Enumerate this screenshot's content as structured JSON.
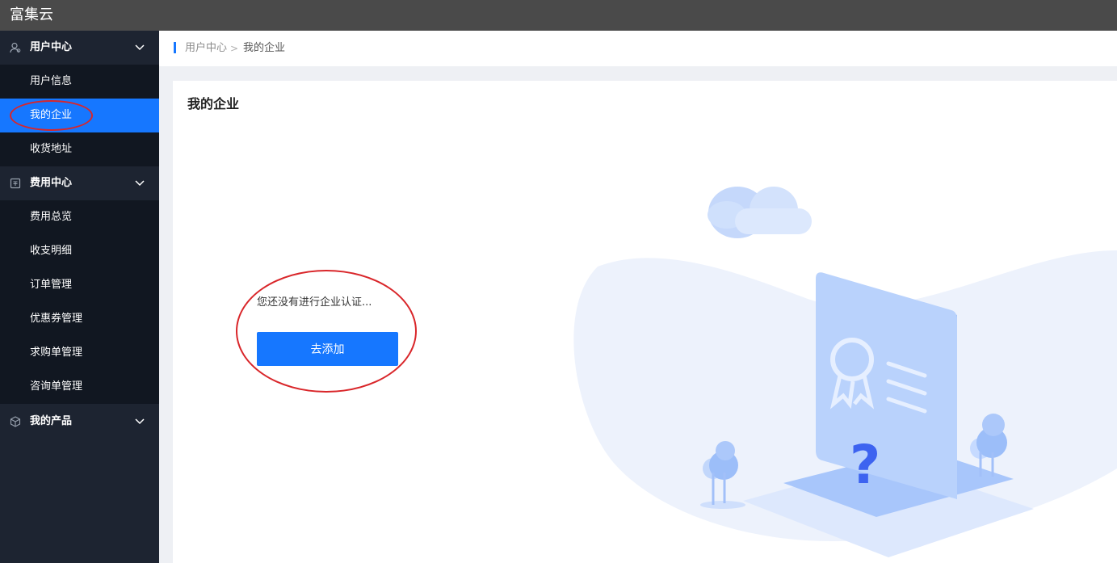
{
  "app": {
    "title": "富集云"
  },
  "sidebar": {
    "groups": [
      {
        "label": "用户中心",
        "icon": "user-icon",
        "items": [
          "用户信息",
          "我的企业",
          "收货地址"
        ]
      },
      {
        "label": "费用中心",
        "icon": "receipt-icon",
        "items": [
          "费用总览",
          "收支明细",
          "订单管理",
          "优惠券管理",
          "求购单管理",
          "咨询单管理"
        ]
      },
      {
        "label": "我的产品",
        "icon": "cube-icon",
        "items": []
      }
    ],
    "active_item": "我的企业"
  },
  "breadcrumb": {
    "items": [
      "用户中心",
      "我的企业"
    ],
    "separator": ">"
  },
  "main": {
    "title": "我的企业",
    "empty_message": "您还没有进行企业认证...",
    "add_button": "去添加"
  },
  "colors": {
    "accent": "#1677ff",
    "sidebar_bg": "#1d2431",
    "topbar_bg": "#4a4a4a",
    "annotation": "#d9262a"
  }
}
